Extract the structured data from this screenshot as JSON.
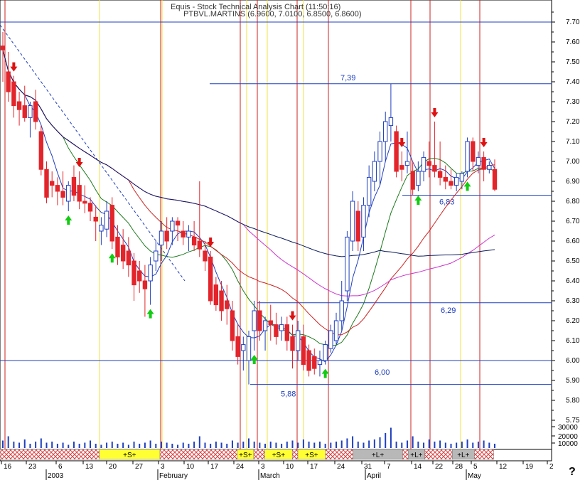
{
  "header": {
    "line1": "Equis - Stock Technical Analysis Chart (11:50:16)",
    "line2": "PTBVL.MARTINS (6.9600, 7.0100, 6.8500, 6.8600)"
  },
  "help_glyph": "?",
  "colors": {
    "up_candle": "#1f3fbf",
    "down_candle": "#e3242b",
    "ma_short": "#1f3fbf",
    "ma_mid": "#1e7a1e",
    "ma_long": "#cc2222",
    "ma_very_long": "#cc33cc",
    "ma_longest": "#0b1b5c",
    "level_line": "#1f3fbf",
    "event_line": "#cc2222",
    "yellow_line": "#f0e040",
    "buy_arrow": "#11cc11",
    "sell_arrow": "#dd1111"
  },
  "chart_data": {
    "type": "candlestick",
    "x_axis_type": "date",
    "ylim": [
      5.68,
      7.77
    ],
    "y_ticks": [
      7.7,
      7.6,
      7.5,
      7.4,
      7.3,
      7.2,
      7.1,
      7.0,
      6.9,
      6.8,
      6.7,
      6.6,
      6.5,
      6.4,
      6.3,
      6.2,
      6.1,
      6.0,
      5.9,
      5.8,
      5.7
    ],
    "y_tick_labels": [
      "7.70",
      "7.60",
      "7.50",
      "7.40",
      "7.30",
      "7.20",
      "7.10",
      "7.00",
      "6.90",
      "6.80",
      "6.70",
      "6.60",
      "6.50",
      "6.40",
      "6.30",
      "6.20",
      "6.10",
      "6.00",
      "5.90",
      "5.80",
      "5.75"
    ],
    "volume_ticks": [
      "30000",
      "20000",
      "10000"
    ],
    "x_day_labels": [
      "16",
      "23",
      "6",
      "13",
      "20",
      "27",
      "3",
      "10",
      "17",
      "24",
      "3",
      "10",
      "17",
      "24",
      "31",
      "7",
      "14",
      "22",
      "28",
      "5",
      "12",
      "19",
      "2"
    ],
    "x_month_labels": [
      "2003",
      "February",
      "March",
      "April",
      "May"
    ],
    "levels": [
      {
        "value": 7.7,
        "label": ""
      },
      {
        "value": 7.39,
        "label": "7,39"
      },
      {
        "value": 6.83,
        "label": "6,83"
      },
      {
        "value": 6.29,
        "label": "6,29"
      },
      {
        "value": 6.0,
        "label": "6,00"
      },
      {
        "value": 5.88,
        "label": "5,88"
      }
    ],
    "candles": [
      {
        "o": 7.58,
        "h": 7.65,
        "l": 7.4,
        "c": 7.56
      },
      {
        "o": 7.45,
        "h": 7.55,
        "l": 7.3,
        "c": 7.35
      },
      {
        "o": 7.4,
        "h": 7.43,
        "l": 7.22,
        "c": 7.28
      },
      {
        "o": 7.3,
        "h": 7.35,
        "l": 7.18,
        "c": 7.26
      },
      {
        "o": 7.28,
        "h": 7.38,
        "l": 7.2,
        "c": 7.22
      },
      {
        "o": 7.22,
        "h": 7.3,
        "l": 7.12,
        "c": 7.28
      },
      {
        "o": 7.3,
        "h": 7.36,
        "l": 7.16,
        "c": 7.2
      },
      {
        "o": 7.15,
        "h": 7.18,
        "l": 6.93,
        "c": 6.96
      },
      {
        "o": 6.96,
        "h": 7.0,
        "l": 6.79,
        "c": 6.82
      },
      {
        "o": 6.9,
        "h": 6.95,
        "l": 6.82,
        "c": 6.88
      },
      {
        "o": 6.88,
        "h": 6.92,
        "l": 6.78,
        "c": 6.85
      },
      {
        "o": 6.85,
        "h": 6.95,
        "l": 6.78,
        "c": 6.82
      },
      {
        "o": 6.8,
        "h": 6.9,
        "l": 6.75,
        "c": 6.88
      },
      {
        "o": 6.92,
        "h": 6.98,
        "l": 6.8,
        "c": 6.83
      },
      {
        "o": 6.88,
        "h": 6.95,
        "l": 6.76,
        "c": 6.8
      },
      {
        "o": 6.8,
        "h": 6.88,
        "l": 6.74,
        "c": 6.79
      },
      {
        "o": 6.79,
        "h": 6.82,
        "l": 6.7,
        "c": 6.75
      },
      {
        "o": 6.72,
        "h": 6.78,
        "l": 6.6,
        "c": 6.7
      },
      {
        "o": 6.65,
        "h": 6.72,
        "l": 6.58,
        "c": 6.68
      },
      {
        "o": 6.66,
        "h": 6.8,
        "l": 6.62,
        "c": 6.75
      },
      {
        "o": 6.78,
        "h": 6.82,
        "l": 6.56,
        "c": 6.6
      },
      {
        "o": 6.62,
        "h": 6.68,
        "l": 6.48,
        "c": 6.52
      },
      {
        "o": 6.58,
        "h": 6.66,
        "l": 6.46,
        "c": 6.5
      },
      {
        "o": 6.55,
        "h": 6.62,
        "l": 6.42,
        "c": 6.48
      },
      {
        "o": 6.5,
        "h": 6.54,
        "l": 6.3,
        "c": 6.38
      },
      {
        "o": 6.45,
        "h": 6.5,
        "l": 6.34,
        "c": 6.4
      },
      {
        "o": 6.4,
        "h": 6.48,
        "l": 6.22,
        "c": 6.36
      },
      {
        "o": 6.4,
        "h": 6.52,
        "l": 6.28,
        "c": 6.48
      },
      {
        "o": 6.5,
        "h": 6.6,
        "l": 6.45,
        "c": 6.55
      },
      {
        "o": 6.58,
        "h": 6.7,
        "l": 6.5,
        "c": 6.65
      },
      {
        "o": 6.65,
        "h": 6.72,
        "l": 6.56,
        "c": 6.6
      },
      {
        "o": 6.65,
        "h": 6.72,
        "l": 6.58,
        "c": 6.7
      },
      {
        "o": 6.7,
        "h": 6.72,
        "l": 6.6,
        "c": 6.68
      },
      {
        "o": 6.65,
        "h": 6.7,
        "l": 6.58,
        "c": 6.62
      },
      {
        "o": 6.62,
        "h": 6.68,
        "l": 6.55,
        "c": 6.65
      },
      {
        "o": 6.62,
        "h": 6.7,
        "l": 6.55,
        "c": 6.58
      },
      {
        "o": 6.6,
        "h": 6.9,
        "l": 6.52,
        "c": 6.56
      },
      {
        "o": 6.55,
        "h": 6.6,
        "l": 6.45,
        "c": 6.5
      },
      {
        "o": 6.52,
        "h": 6.55,
        "l": 6.28,
        "c": 6.3
      },
      {
        "o": 6.38,
        "h": 6.42,
        "l": 6.25,
        "c": 6.28
      },
      {
        "o": 6.35,
        "h": 6.4,
        "l": 6.2,
        "c": 6.25
      },
      {
        "o": 6.3,
        "h": 6.38,
        "l": 6.18,
        "c": 6.26
      },
      {
        "o": 6.25,
        "h": 6.3,
        "l": 6.05,
        "c": 6.1
      },
      {
        "o": 6.12,
        "h": 6.18,
        "l": 5.98,
        "c": 6.02
      },
      {
        "o": 6.05,
        "h": 6.12,
        "l": 5.95,
        "c": 6.08
      },
      {
        "o": 6.0,
        "h": 6.15,
        "l": 5.88,
        "c": 6.12
      },
      {
        "o": 6.15,
        "h": 6.3,
        "l": 6.05,
        "c": 6.25
      },
      {
        "o": 6.25,
        "h": 6.3,
        "l": 6.1,
        "c": 6.15
      },
      {
        "o": 6.15,
        "h": 6.22,
        "l": 6.05,
        "c": 6.2
      },
      {
        "o": 6.2,
        "h": 6.28,
        "l": 6.1,
        "c": 6.18
      },
      {
        "o": 6.18,
        "h": 6.24,
        "l": 6.08,
        "c": 6.12
      },
      {
        "o": 6.15,
        "h": 6.22,
        "l": 6.1,
        "c": 6.18
      },
      {
        "o": 6.18,
        "h": 6.22,
        "l": 6.05,
        "c": 6.1
      },
      {
        "o": 6.12,
        "h": 6.18,
        "l": 5.96,
        "c": 6.05
      },
      {
        "o": 6.05,
        "h": 6.2,
        "l": 6.0,
        "c": 6.15
      },
      {
        "o": 6.12,
        "h": 6.18,
        "l": 5.95,
        "c": 5.98
      },
      {
        "o": 6.05,
        "h": 6.08,
        "l": 5.92,
        "c": 5.95
      },
      {
        "o": 6.02,
        "h": 6.06,
        "l": 5.93,
        "c": 5.96
      },
      {
        "o": 5.98,
        "h": 6.05,
        "l": 5.92,
        "c": 6.0
      },
      {
        "o": 6.0,
        "h": 6.1,
        "l": 5.98,
        "c": 6.08
      },
      {
        "o": 6.06,
        "h": 6.18,
        "l": 6.04,
        "c": 6.15
      },
      {
        "o": 6.1,
        "h": 6.24,
        "l": 6.08,
        "c": 6.2
      },
      {
        "o": 6.2,
        "h": 6.4,
        "l": 6.15,
        "c": 6.3
      },
      {
        "o": 6.35,
        "h": 6.65,
        "l": 6.3,
        "c": 6.62
      },
      {
        "o": 6.6,
        "h": 6.85,
        "l": 6.55,
        "c": 6.8
      },
      {
        "o": 6.75,
        "h": 6.8,
        "l": 6.55,
        "c": 6.6
      },
      {
        "o": 6.62,
        "h": 6.82,
        "l": 6.55,
        "c": 6.78
      },
      {
        "o": 6.78,
        "h": 6.98,
        "l": 6.72,
        "c": 6.92
      },
      {
        "o": 6.9,
        "h": 7.05,
        "l": 6.85,
        "c": 7.0
      },
      {
        "o": 7.0,
        "h": 7.15,
        "l": 6.88,
        "c": 7.1
      },
      {
        "o": 7.1,
        "h": 7.25,
        "l": 7.0,
        "c": 7.2
      },
      {
        "o": 7.18,
        "h": 7.39,
        "l": 7.1,
        "c": 7.22
      },
      {
        "o": 7.15,
        "h": 7.18,
        "l": 6.92,
        "c": 6.95
      },
      {
        "o": 6.98,
        "h": 7.05,
        "l": 6.9,
        "c": 6.96
      },
      {
        "o": 6.98,
        "h": 7.15,
        "l": 6.94,
        "c": 7.0
      },
      {
        "o": 6.95,
        "h": 7.0,
        "l": 6.83,
        "c": 6.86
      },
      {
        "o": 6.88,
        "h": 7.0,
        "l": 6.85,
        "c": 6.95
      },
      {
        "o": 6.95,
        "h": 7.05,
        "l": 6.9,
        "c": 7.02
      },
      {
        "o": 7.0,
        "h": 7.1,
        "l": 6.92,
        "c": 6.98
      },
      {
        "o": 6.98,
        "h": 7.2,
        "l": 6.92,
        "c": 6.95
      },
      {
        "o": 6.95,
        "h": 7.1,
        "l": 6.88,
        "c": 6.92
      },
      {
        "o": 6.92,
        "h": 6.98,
        "l": 6.86,
        "c": 6.9
      },
      {
        "o": 6.9,
        "h": 6.96,
        "l": 6.86,
        "c": 6.88
      },
      {
        "o": 6.88,
        "h": 6.94,
        "l": 6.85,
        "c": 6.92
      },
      {
        "o": 6.9,
        "h": 6.95,
        "l": 6.86,
        "c": 6.94
      },
      {
        "o": 6.95,
        "h": 7.12,
        "l": 6.92,
        "c": 7.1
      },
      {
        "o": 7.1,
        "h": 7.12,
        "l": 6.95,
        "c": 7.0
      },
      {
        "o": 6.98,
        "h": 7.05,
        "l": 6.94,
        "c": 7.02
      },
      {
        "o": 7.02,
        "h": 7.05,
        "l": 6.9,
        "c": 6.96
      },
      {
        "o": 6.96,
        "h": 7.0,
        "l": 6.94,
        "c": 6.98
      },
      {
        "o": 6.96,
        "h": 7.01,
        "l": 6.85,
        "c": 6.86
      }
    ],
    "volumes": [
      0.35,
      0.55,
      0.3,
      0.25,
      0.4,
      0.2,
      0.3,
      0.45,
      0.25,
      0.3,
      0.2,
      0.25,
      0.15,
      0.3,
      0.2,
      0.25,
      0.35,
      0.2,
      0.15,
      0.25,
      0.3,
      0.2,
      0.25,
      0.15,
      0.3,
      0.2,
      0.25,
      0.35,
      0.2,
      0.3,
      0.25,
      0.2,
      0.15,
      0.25,
      0.2,
      0.3,
      0.55,
      0.25,
      0.2,
      0.3,
      0.25,
      0.2,
      0.35,
      0.25,
      0.3,
      0.45,
      0.3,
      0.25,
      0.2,
      0.3,
      0.25,
      0.2,
      0.3,
      0.35,
      0.25,
      0.4,
      0.3,
      0.25,
      0.3,
      0.2,
      0.25,
      0.3,
      0.35,
      0.45,
      0.55,
      0.3,
      0.25,
      0.35,
      0.4,
      0.5,
      0.7,
      0.95,
      0.3,
      0.25,
      0.35,
      0.55,
      0.3,
      0.25,
      0.4,
      0.3,
      0.35,
      0.25,
      0.2,
      0.25,
      0.3,
      0.4,
      0.25,
      0.3,
      0.35,
      0.25,
      0.2
    ],
    "signals": [
      {
        "i": 2,
        "type": "sell"
      },
      {
        "i": 14,
        "type": "sell"
      },
      {
        "i": 12,
        "type": "buy"
      },
      {
        "i": 20,
        "type": "buy"
      },
      {
        "i": 27,
        "type": "buy"
      },
      {
        "i": 38,
        "type": "sell"
      },
      {
        "i": 46,
        "type": "buy"
      },
      {
        "i": 53,
        "type": "sell"
      },
      {
        "i": 59,
        "type": "buy"
      },
      {
        "i": 73,
        "type": "sell"
      },
      {
        "i": 76,
        "type": "buy"
      },
      {
        "i": 79,
        "type": "sell"
      },
      {
        "i": 85,
        "type": "buy"
      },
      {
        "i": 88,
        "type": "sell"
      }
    ],
    "bands": [
      {
        "start": 0.0,
        "end": 0.18,
        "label": "",
        "kind": "hatch"
      },
      {
        "start": 0.18,
        "end": 0.29,
        "label": "+S+",
        "kind": "yellow"
      },
      {
        "start": 0.29,
        "end": 0.43,
        "label": "",
        "kind": "hatch"
      },
      {
        "start": 0.43,
        "end": 0.46,
        "label": "+S+",
        "kind": "yellow"
      },
      {
        "start": 0.46,
        "end": 0.48,
        "label": "",
        "kind": "hatch"
      },
      {
        "start": 0.48,
        "end": 0.53,
        "label": "+S+",
        "kind": "yellow"
      },
      {
        "start": 0.53,
        "end": 0.54,
        "label": "",
        "kind": "hatch"
      },
      {
        "start": 0.54,
        "end": 0.59,
        "label": "+S+",
        "kind": "yellow"
      },
      {
        "start": 0.59,
        "end": 0.64,
        "label": "",
        "kind": "hatch"
      },
      {
        "start": 0.64,
        "end": 0.73,
        "label": "+L+",
        "kind": "gray"
      },
      {
        "start": 0.73,
        "end": 0.74,
        "label": "",
        "kind": "hatch"
      },
      {
        "start": 0.74,
        "end": 0.77,
        "label": "+L+",
        "kind": "gray"
      },
      {
        "start": 0.77,
        "end": 0.82,
        "label": "",
        "kind": "hatch"
      },
      {
        "start": 0.82,
        "end": 0.86,
        "label": "+L+",
        "kind": "gray"
      },
      {
        "start": 0.86,
        "end": 0.895,
        "label": "",
        "kind": "hatch"
      }
    ]
  }
}
